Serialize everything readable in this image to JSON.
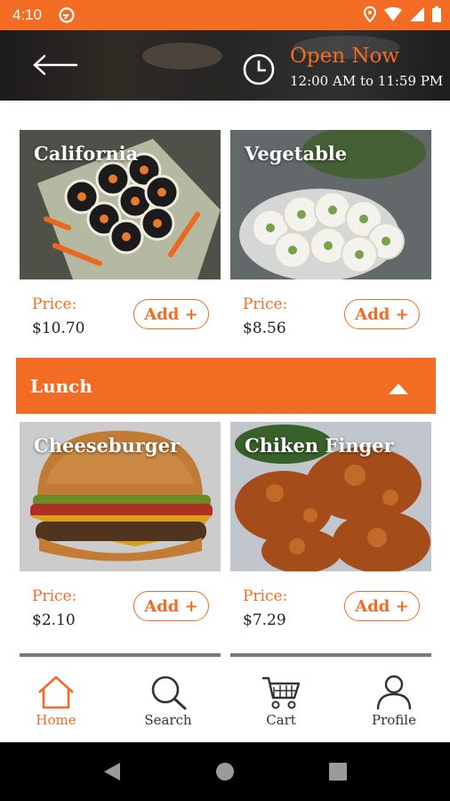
{
  "status_bar": {
    "time": "4:10"
  },
  "header": {
    "open_status": "Open Now",
    "hours": "12:00 AM to 11:59 PM"
  },
  "menu": {
    "top_items": [
      {
        "name": "California",
        "price_label": "Price:",
        "price": "$10.70",
        "add_label": "Add +"
      },
      {
        "name": "Vegetable",
        "price_label": "Price:",
        "price": "$8.56",
        "add_label": "Add +"
      }
    ],
    "section": {
      "title": "Lunch",
      "items": [
        {
          "name": "Cheeseburger",
          "price_label": "Price:",
          "price": "$2.10",
          "add_label": "Add +"
        },
        {
          "name": "Chiken Finger",
          "price_label": "Price:",
          "price": "$7.29",
          "add_label": "Add +"
        }
      ]
    }
  },
  "bottom_nav": {
    "items": [
      {
        "label": "Home",
        "icon": "home-icon",
        "active": true
      },
      {
        "label": "Search",
        "icon": "search-icon",
        "active": false
      },
      {
        "label": "Cart",
        "icon": "cart-icon",
        "active": false
      },
      {
        "label": "Profile",
        "icon": "profile-icon",
        "active": false
      }
    ]
  },
  "colors": {
    "accent": "#f26c23",
    "status_bar": "#f26c23",
    "system_nav": "#000000"
  }
}
